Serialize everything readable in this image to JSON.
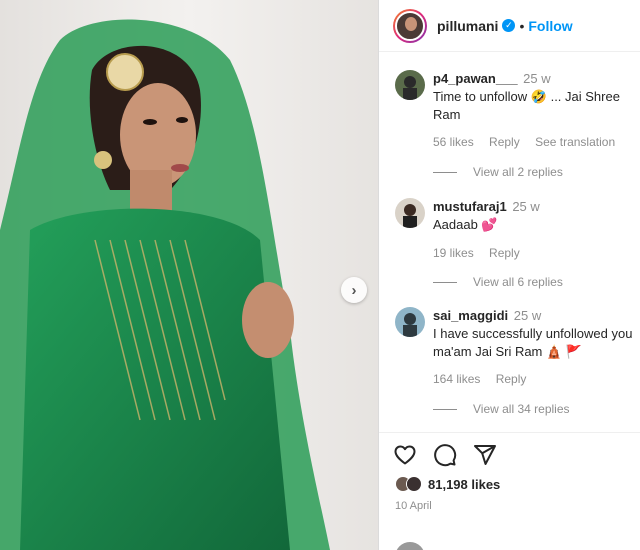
{
  "post": {
    "username": "pillumani",
    "separator": "•",
    "follow_label": "Follow",
    "likes": "81,198 likes",
    "date": "10 April"
  },
  "comments": [
    {
      "user": "p4_pawan___",
      "time": "25 w",
      "text_line1": "Time to unfollow 🤣 ... Jai Shree",
      "text_line2": "Ram",
      "likes": "56 likes",
      "reply": "Reply",
      "extra": "See translation",
      "view_replies": "View all 2 replies"
    },
    {
      "user": "mustufaraj1",
      "time": "25 w",
      "text_line1": "Aadaab 💕",
      "text_line2": "",
      "likes": "19 likes",
      "reply": "Reply",
      "extra": "",
      "view_replies": "View all 6 replies"
    },
    {
      "user": "sai_maggidi",
      "time": "25 w",
      "text_line1": "I have successfully unfollowed you",
      "text_line2": "ma'am Jai Sri Ram 🛕 🚩",
      "likes": "164 likes",
      "reply": "Reply",
      "extra": "",
      "view_replies": "View all 34 replies"
    }
  ],
  "icons": [
    "heart-icon",
    "comment-icon",
    "share-icon",
    "verified-icon",
    "chevron-right-icon"
  ],
  "colors": {
    "accent": "#0095f6",
    "green_outfit": "#1e8a4c",
    "muted": "#8e8e8e"
  }
}
